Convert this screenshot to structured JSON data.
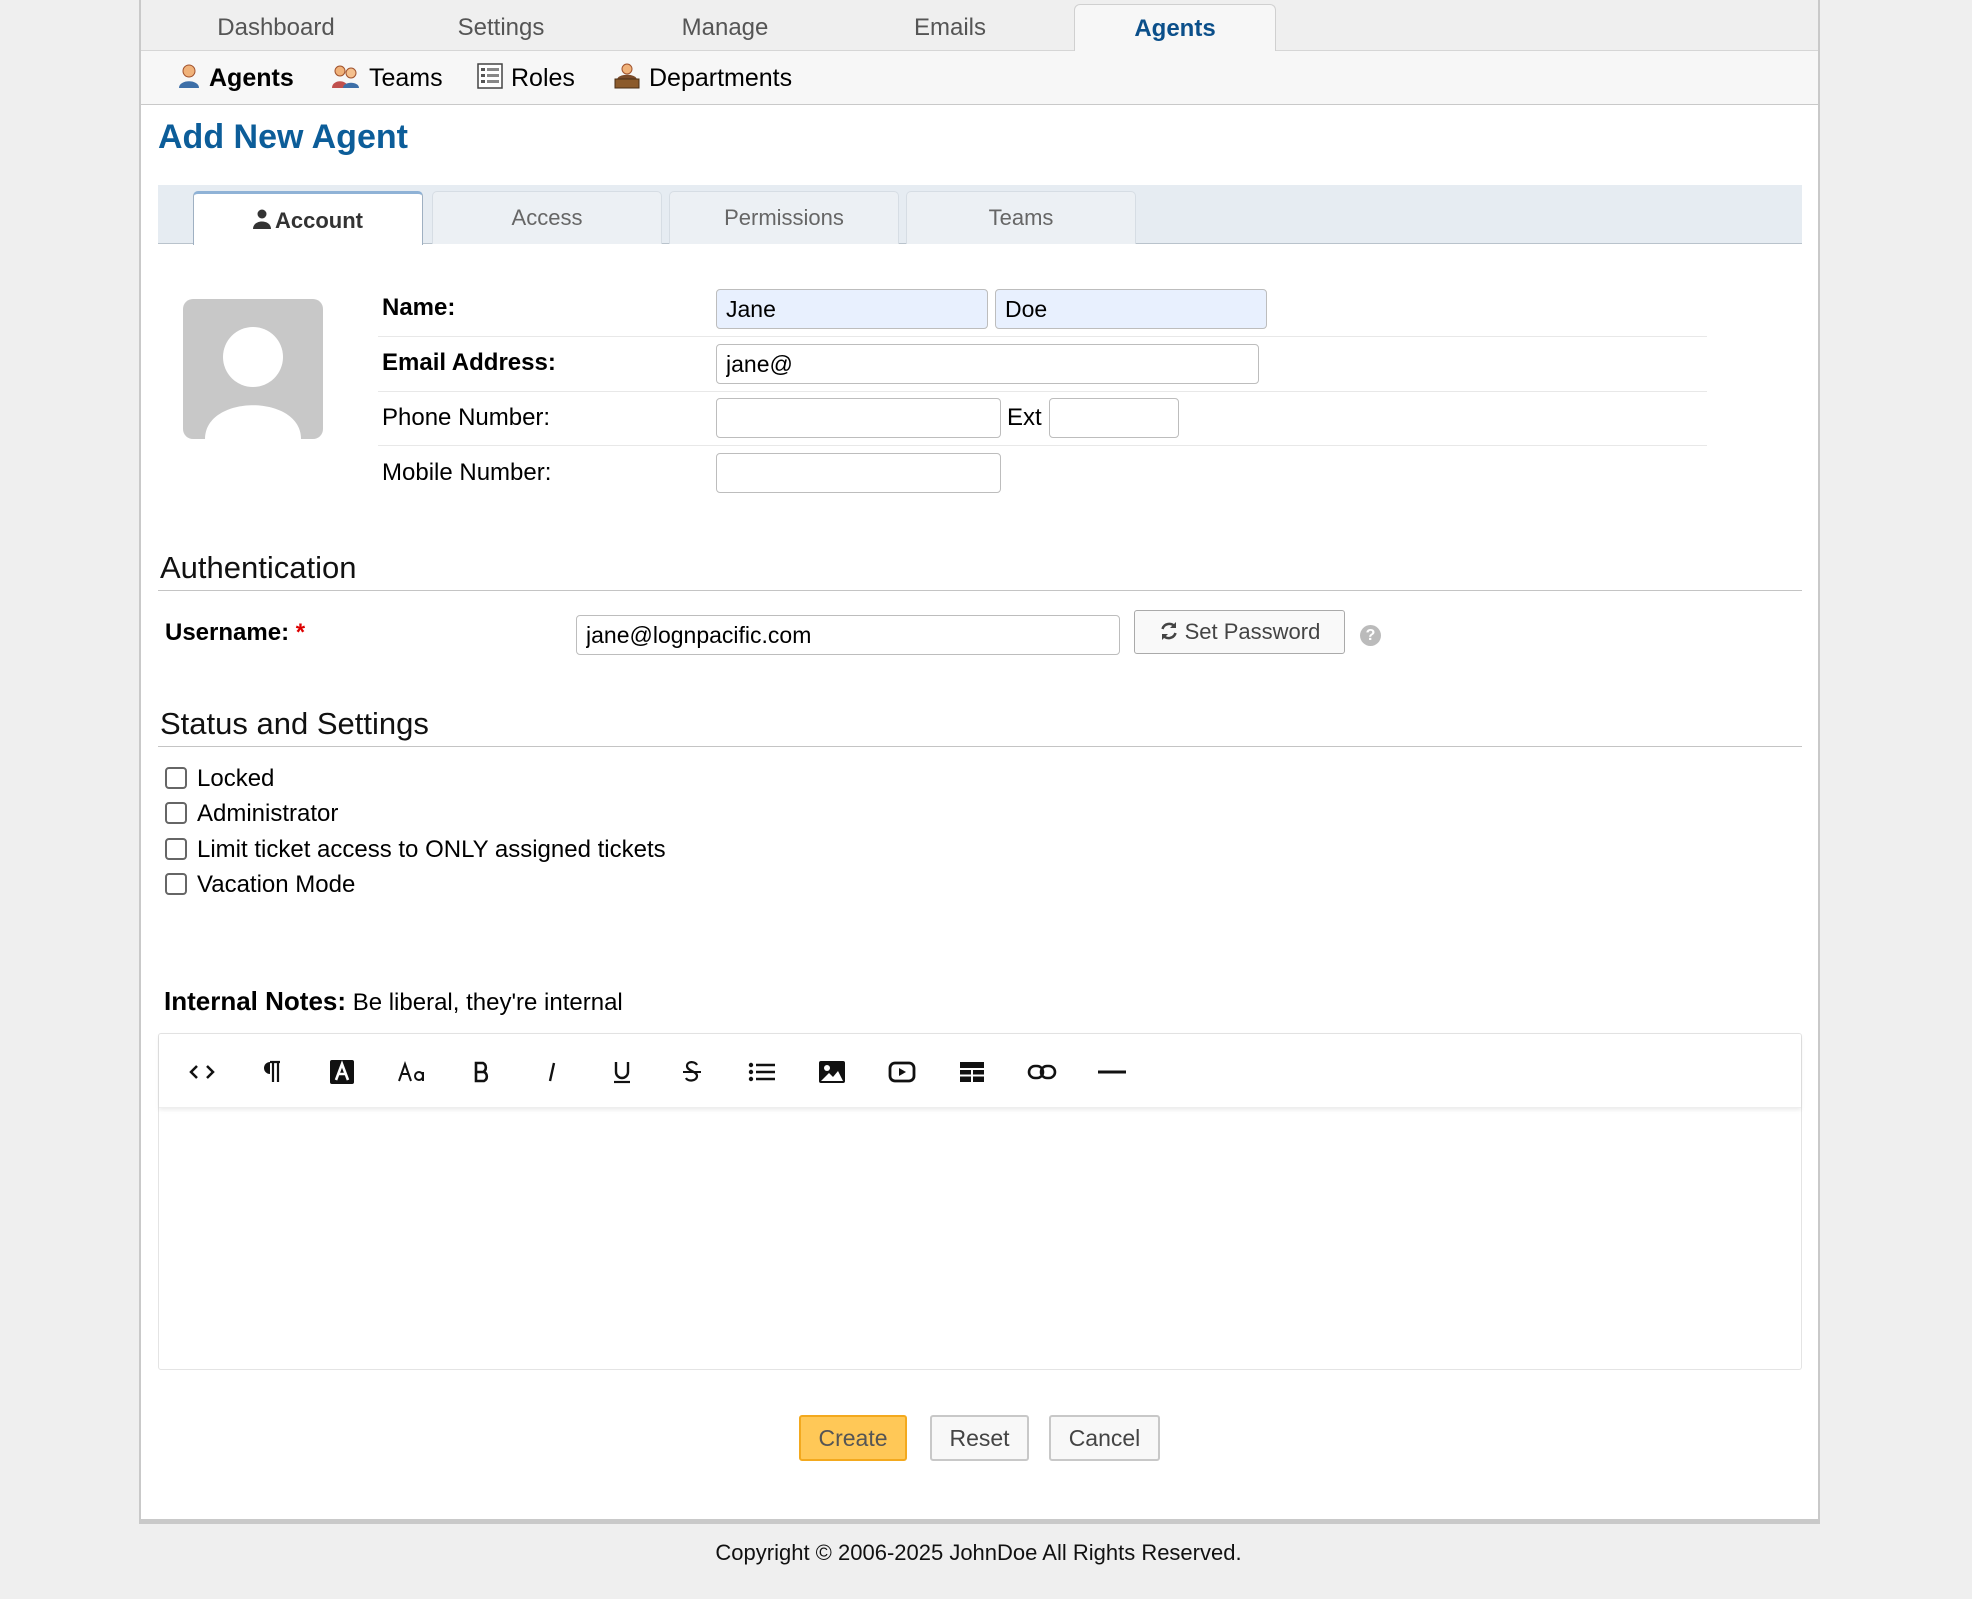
{
  "nav": {
    "tabs": [
      {
        "label": "Dashboard"
      },
      {
        "label": "Settings"
      },
      {
        "label": "Manage"
      },
      {
        "label": "Emails"
      },
      {
        "label": "Agents"
      }
    ],
    "active": "Agents"
  },
  "subnav": {
    "items": [
      {
        "label": "Agents",
        "icon": "agent-icon"
      },
      {
        "label": "Teams",
        "icon": "teams-icon"
      },
      {
        "label": "Roles",
        "icon": "roles-icon"
      },
      {
        "label": "Departments",
        "icon": "departments-icon"
      }
    ],
    "active": "Agents"
  },
  "page": {
    "title": "Add New Agent"
  },
  "form_tabs": [
    {
      "label": "Account"
    },
    {
      "label": "Access"
    },
    {
      "label": "Permissions"
    },
    {
      "label": "Teams"
    }
  ],
  "account": {
    "name_label": "Name:",
    "first_name": "Jane",
    "last_name": "Doe",
    "email_label": "Email Address:",
    "email": "jane@",
    "phone_label": "Phone Number:",
    "phone": "",
    "ext_label": "Ext",
    "ext": "",
    "mobile_label": "Mobile Number:",
    "mobile": ""
  },
  "authentication": {
    "title": "Authentication",
    "username_label": "Username:",
    "required_mark": "*",
    "username": "jane@lognpacific.com",
    "set_password_label": "Set Password",
    "help": "?"
  },
  "status": {
    "title": "Status and Settings",
    "options": [
      {
        "label": "Locked",
        "checked": false
      },
      {
        "label": "Administrator",
        "checked": false
      },
      {
        "label": "Limit ticket access to ONLY assigned tickets",
        "checked": false
      },
      {
        "label": "Vacation Mode",
        "checked": false
      }
    ]
  },
  "notes": {
    "label": "Internal Notes:",
    "hint": "Be liberal, they're internal",
    "content": ""
  },
  "actions": {
    "create": "Create",
    "reset": "Reset",
    "cancel": "Cancel"
  },
  "footer": {
    "copyright": "Copyright © 2006-2025 JohnDoe All Rights Reserved."
  },
  "colors": {
    "accent": "#0c5d99",
    "primary_button": "#ffc857",
    "required": "#dd0000"
  }
}
